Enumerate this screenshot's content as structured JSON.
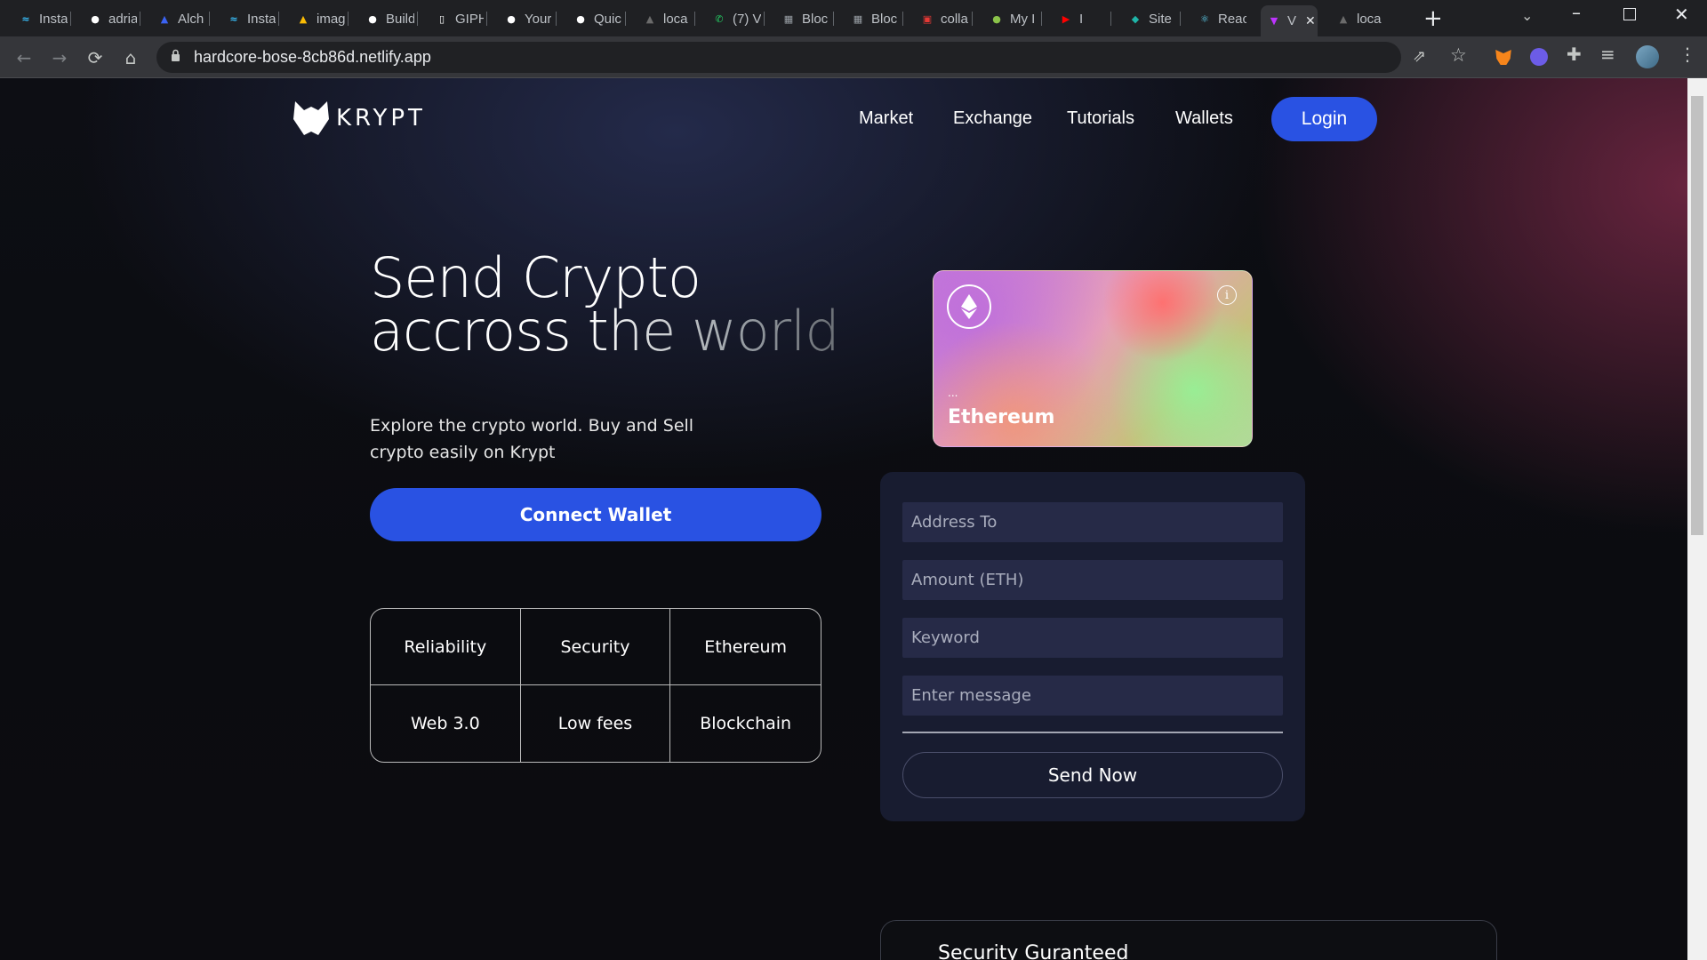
{
  "browser": {
    "tabs": [
      {
        "label": "Insta",
        "icon": "tailwind-icon",
        "color": "#38bdf8"
      },
      {
        "label": "adria",
        "icon": "github-icon",
        "color": "#ffffff"
      },
      {
        "label": "Alch",
        "icon": "alchemy-icon",
        "color": "#3b63f3"
      },
      {
        "label": "Insta",
        "icon": "tailwind-icon",
        "color": "#38bdf8"
      },
      {
        "label": "imag",
        "icon": "google-drive-icon",
        "color": "#fbbc04"
      },
      {
        "label": "Build",
        "icon": "github-icon",
        "color": "#ffffff"
      },
      {
        "label": "GIPH",
        "icon": "giphy-icon",
        "color": "#ffffff"
      },
      {
        "label": "Your",
        "icon": "github-icon",
        "color": "#ffffff"
      },
      {
        "label": "Quic",
        "icon": "github-icon",
        "color": "#ffffff"
      },
      {
        "label": "loca",
        "icon": "triangle-icon",
        "color": "#6b6b6b"
      },
      {
        "label": "(7) V",
        "icon": "whatsapp-icon",
        "color": "#25d366"
      },
      {
        "label": "Bloc",
        "icon": "block-icon",
        "color": "#9aa0a6"
      },
      {
        "label": "Bloc",
        "icon": "block-icon",
        "color": "#9aa0a6"
      },
      {
        "label": "colla",
        "icon": "calendar-icon",
        "color": "#e53935"
      },
      {
        "label": "My I",
        "icon": "spotify-icon",
        "color": "#8bc34a"
      },
      {
        "label": "I",
        "icon": "youtube-icon",
        "color": "#ff0000"
      },
      {
        "label": "Site",
        "icon": "netlify-icon",
        "color": "#1fb5a8"
      },
      {
        "label": "Reac",
        "icon": "react-icon",
        "color": "#61dafb"
      },
      {
        "label": "V",
        "icon": "vite-icon",
        "color": "#bd34fe"
      },
      {
        "label": "loca",
        "icon": "triangle-icon",
        "color": "#6b6b6b"
      }
    ],
    "new_tab": "+",
    "url": "hardcore-bose-8cb86d.netlify.app"
  },
  "site": {
    "logo": "KRYPT",
    "nav": [
      "Market",
      "Exchange",
      "Tutorials",
      "Wallets"
    ],
    "login": "Login",
    "hero_line1": "Send Crypto",
    "hero_line2a": "accross ",
    "hero_line2b": "the world",
    "hero_sub": "Explore the crypto world. Buy and Sell crypto easily on Krypt",
    "connect": "Connect Wallet",
    "features": [
      "Reliability",
      "Security",
      "Ethereum",
      "Web 3.0",
      "Low fees",
      "Blockchain"
    ],
    "card": {
      "address": "...",
      "network": "Ethereum"
    },
    "form": {
      "address_placeholder": "Address To",
      "amount_placeholder": "Amount (ETH)",
      "keyword_placeholder": "Keyword",
      "message_placeholder": "Enter message",
      "send": "Send Now"
    },
    "security_title": "Security Guranteed"
  }
}
